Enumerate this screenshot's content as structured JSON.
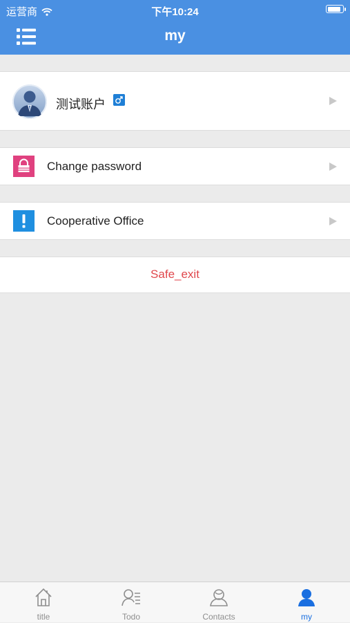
{
  "status_bar": {
    "carrier": "运营商",
    "time": "下午10:24"
  },
  "nav": {
    "title": "my",
    "menu_icon": "list-menu-icon"
  },
  "profile": {
    "name": "测试账户",
    "gender_icon": "male-icon"
  },
  "rows": [
    {
      "label": "Change password",
      "icon": "lock-icon",
      "color": "#e0417f"
    },
    {
      "label": "Cooperative Office",
      "icon": "exclamation-icon",
      "color": "#1f8fe0"
    }
  ],
  "exit": {
    "label": "Safe_exit",
    "color": "#e0474c"
  },
  "tabs": [
    {
      "label": "title",
      "icon": "home-icon"
    },
    {
      "label": "Todo",
      "icon": "todo-person-icon"
    },
    {
      "label": "Contacts",
      "icon": "contacts-icon"
    },
    {
      "label": "my",
      "icon": "person-icon",
      "active": true
    }
  ],
  "colors": {
    "header": "#4a90e2",
    "active_tab": "#1a6fe0",
    "background": "#ebebeb"
  }
}
